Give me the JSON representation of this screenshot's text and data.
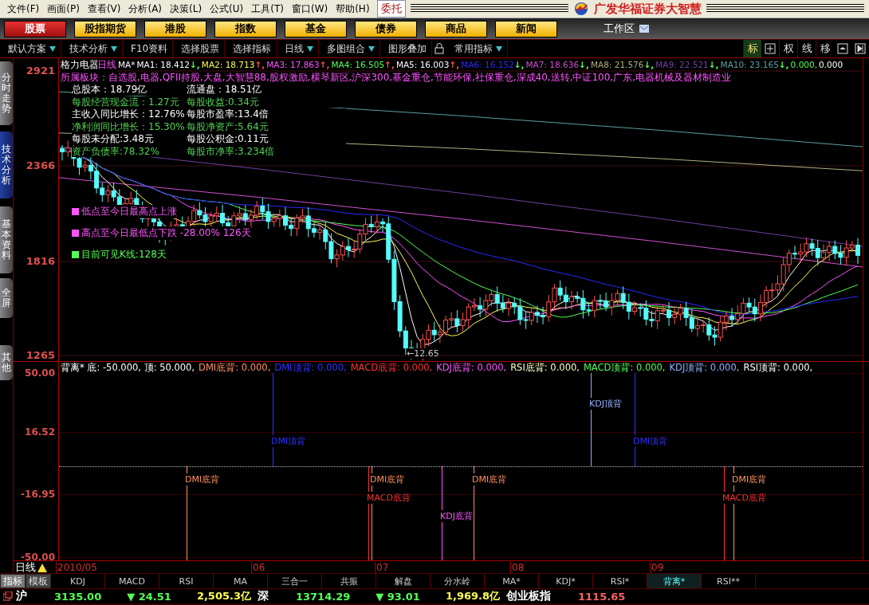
{
  "menu": [
    "文件(F)",
    "画面(P)",
    "查看(V)",
    "分析(A)",
    "决策(L)",
    "公式(U)",
    "工具(T)",
    "窗口(W)",
    "帮助(H)"
  ],
  "trade_button": "委托",
  "brand": "广发华福证券大智慧",
  "market_tabs": [
    {
      "label": "股票",
      "selected": true
    },
    {
      "label": "股指期货",
      "selected": false
    },
    {
      "label": "港股",
      "selected": false
    },
    {
      "label": "指数",
      "selected": false
    },
    {
      "label": "基金",
      "selected": false
    },
    {
      "label": "债券",
      "selected": false
    },
    {
      "label": "商品",
      "selected": false
    },
    {
      "label": "新闻",
      "selected": false
    }
  ],
  "workspace": "工作区",
  "toolbar": [
    {
      "label": "默认方案",
      "dropdown": true
    },
    {
      "label": "技术分析",
      "dropdown": true
    },
    {
      "label": "F10资料",
      "dropdown": false
    },
    {
      "label": "选择股票",
      "dropdown": false
    },
    {
      "label": "选择指标",
      "dropdown": false
    },
    {
      "label": "日线",
      "dropdown": true
    },
    {
      "label": "多图组合",
      "dropdown": true
    },
    {
      "label": "图形叠加",
      "dropdown": false
    }
  ],
  "toolbar_extra": {
    "label": "常用指标",
    "dropdown": true
  },
  "right_tools": [
    {
      "label": "标",
      "selected": true
    },
    {
      "label": "权",
      "selected": false
    },
    {
      "label": "线",
      "selected": false
    },
    {
      "label": "移",
      "selected": false
    }
  ],
  "side_tabs": [
    {
      "label": "分时走势",
      "selected": false
    },
    {
      "label": "技术分析",
      "selected": true
    },
    {
      "label": "基本资料",
      "selected": false
    },
    {
      "label": "全屏",
      "selected": false
    },
    {
      "label": "其他",
      "selected": false
    }
  ],
  "price_chart": {
    "stock": "格力电器",
    "period": "日线",
    "indicator": "MA*",
    "ma": [
      {
        "text": "MA1: 18.412",
        "arrow": "↓,",
        "up": false,
        "color": "#ffffff"
      },
      {
        "text": "MA2: 18.713",
        "arrow": "↑,",
        "up": true,
        "color": "#ffff54"
      },
      {
        "text": "MA3: 17.863",
        "arrow": "↑,",
        "up": true,
        "color": "#ff54ff"
      },
      {
        "text": "MA4: 16.505",
        "arrow": "↑,",
        "up": true,
        "color": "#54ff54"
      },
      {
        "text": "MA5: 16.003",
        "arrow": "↑,",
        "up": true,
        "color": "#ffffff"
      },
      {
        "text": "MA6: 16.152",
        "arrow": "↓,",
        "up": false,
        "color": "#2a2aff"
      },
      {
        "text": "MA7: 18.636",
        "arrow": "↓,",
        "up": false,
        "color": "#d050d0"
      },
      {
        "text": "MA8: 21.576",
        "arrow": "↓,",
        "up": false,
        "color": "#b0b080"
      },
      {
        "text": "MA9: 22.521",
        "arrow": "↓,",
        "up": false,
        "color": "#7040a0"
      },
      {
        "text": "MA10: 23.165",
        "arrow": "↓,",
        "up": false,
        "color": "#5aa0a0"
      },
      {
        "text": "0.000,",
        "color": "#54ff54"
      },
      {
        "text": "0.000",
        "color": "#ffffff"
      }
    ],
    "sectors": "所属板块：自选股,电器,QFII持股,大盘,大智慧88,股权激励,横琴新区,沪深300,基金重仓,节能环保,社保重仓,深成40,送转,中证100,广东,电器机械及器材制造业",
    "fundamentals": [
      {
        "text": "总股本：18.79亿",
        "color": "#ffffff"
      },
      {
        "text": "流通盘：18.51亿",
        "color": "#ffffff"
      },
      {
        "text": "每股经营现金流：1.27元",
        "color": "#54d054"
      },
      {
        "text": "每股收益:0.34元",
        "color": "#54d054"
      },
      {
        "text": "主收入同比增长：12.76%",
        "color": "#ffffff"
      },
      {
        "text": "每股市盈率:13.4倍",
        "color": "#ffffff"
      },
      {
        "text": "净利润同比增长：15.30%",
        "color": "#54d054"
      },
      {
        "text": "每股净资产:5.64元",
        "color": "#54d054"
      },
      {
        "text": "每股未分配:3.48元",
        "color": "#ffffff"
      },
      {
        "text": "每股公积金:0.11元",
        "color": "#ffffff"
      },
      {
        "text": "资产负债率:78.32%",
        "color": "#54d054"
      },
      {
        "text": "每股市净率:3.234倍",
        "color": "#54d054"
      }
    ],
    "legend": [
      {
        "text": "低点至今日最高点上涨",
        "color": "#ff54ff"
      },
      {
        "text": "高点至今日最低点下跌 -28.00%   126天",
        "color": "#ff54ff"
      },
      {
        "text": "目前可见K线:128天",
        "color": "#54ff54"
      }
    ],
    "low_label": "←12.65",
    "y_axis": [
      "2921",
      "2366",
      "1816",
      "1265"
    ]
  },
  "indicator_chart": {
    "header": [
      {
        "text": "背离* 底: -50.000, 顶: 50.000,",
        "color": "#ffffff"
      },
      {
        "text": "DMI底背: 0.000,",
        "color": "#ff9060"
      },
      {
        "text": "DMI顶背: 0.000,",
        "color": "#3030ff"
      },
      {
        "text": "MACD底背: 0.000,",
        "color": "#ff3030"
      },
      {
        "text": "KDJ底背: 0.000,",
        "color": "#ff54ff"
      },
      {
        "text": "RSI底背: 0.000,",
        "color": "#ffffc0"
      },
      {
        "text": "MACD顶背: 0.000,",
        "color": "#54ff54"
      },
      {
        "text": "KDJ顶背: 0.000,",
        "color": "#90b0ff"
      },
      {
        "text": "RSI顶背: 0.000,",
        "color": "#ffffff"
      }
    ],
    "y_axis": [
      "50.00",
      "16.52",
      "-16.95",
      "-50.00"
    ],
    "signals": [
      {
        "label": "DMI顶背",
        "kind": "top",
        "color": "#3030ff"
      },
      {
        "label": "KDJ顶背",
        "kind": "top",
        "color": "#90b0ff"
      },
      {
        "label": "DMI顶背",
        "kind": "top",
        "color": "#3030ff"
      },
      {
        "label": "DMI底背",
        "kind": "bottom",
        "color": "#ff9060"
      },
      {
        "label": "MACD底背",
        "kind": "bottom",
        "color": "#ff3030"
      },
      {
        "label": "DMI底背",
        "kind": "bottom",
        "color": "#ff9060"
      },
      {
        "label": "KDJ底背",
        "kind": "bottom",
        "color": "#ff54ff"
      },
      {
        "label": "DMI底背",
        "kind": "bottom",
        "color": "#ff9060"
      },
      {
        "label": "MACD底背",
        "kind": "bottom",
        "color": "#ff3030"
      },
      {
        "label": "DMI底背",
        "kind": "bottom",
        "color": "#ff9060"
      }
    ]
  },
  "date_axis": {
    "period": "日线",
    "labels": [
      "2010/05",
      "06",
      "07",
      "08",
      "09"
    ]
  },
  "indicator_tabs": {
    "groups": [
      {
        "label": "指标",
        "selected": true
      },
      {
        "label": "模板",
        "selected": false
      }
    ],
    "items": [
      {
        "label": "KDJ",
        "selected": false
      },
      {
        "label": "MACD",
        "selected": false
      },
      {
        "label": "RSI",
        "selected": false
      },
      {
        "label": "MA",
        "selected": false
      },
      {
        "label": "三合一",
        "selected": false
      },
      {
        "label": "共振",
        "selected": false
      },
      {
        "label": "解盘",
        "selected": false
      },
      {
        "label": "分水岭",
        "selected": false
      },
      {
        "label": "MA*",
        "selected": false
      },
      {
        "label": "KDJ*",
        "selected": false
      },
      {
        "label": "RSI*",
        "selected": false
      },
      {
        "label": "背离*",
        "selected": true
      },
      {
        "label": "RSI**",
        "selected": false
      }
    ]
  },
  "ticker": [
    {
      "text": "沪",
      "kind": "label"
    },
    {
      "text": "3135.00",
      "kind": "falling"
    },
    {
      "text": "▼ 24.51",
      "kind": "falling"
    },
    {
      "text": "2,505.3亿",
      "kind": "amount"
    },
    {
      "text": "深",
      "kind": "label"
    },
    {
      "text": "13714.29",
      "kind": "falling"
    },
    {
      "text": "▼ 93.01",
      "kind": "falling"
    },
    {
      "text": "1,969.8亿",
      "kind": "amount"
    },
    {
      "text": "创业板指",
      "kind": "label"
    },
    {
      "text": "1115.65",
      "kind": "rising"
    }
  ]
}
